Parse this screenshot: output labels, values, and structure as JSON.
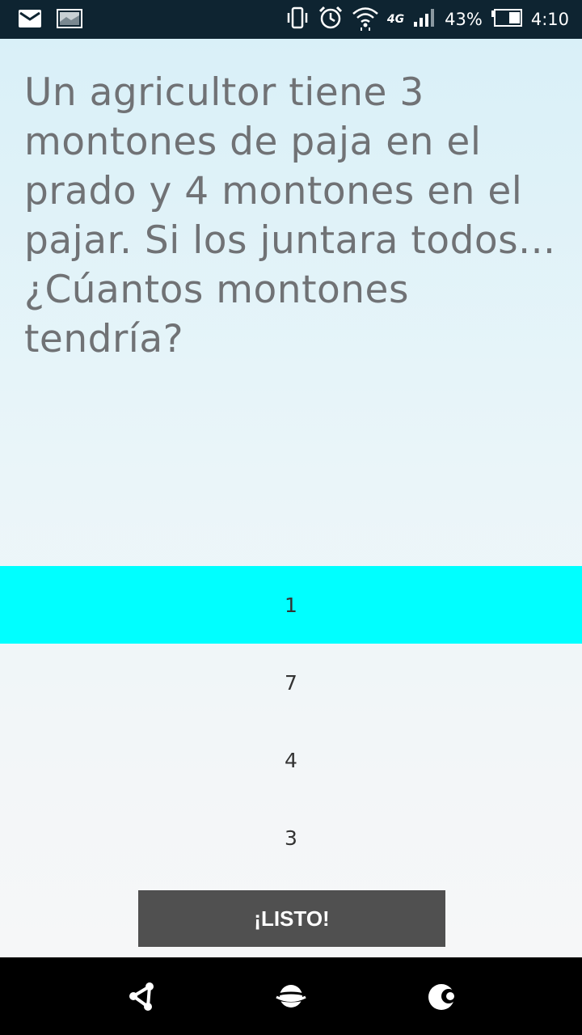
{
  "status_bar": {
    "left_icons": [
      "mail-icon",
      "image-icon"
    ],
    "right_icons": [
      "vibrate-icon",
      "alarm-icon",
      "wifi-icon",
      "signal-icon",
      "battery-icon"
    ],
    "network_label": "4G",
    "battery_percent": "43%",
    "battery_level": 0.43,
    "time": "4:10"
  },
  "quiz": {
    "question": "Un agricultor tiene 3 montones de paja en el prado y 4 montones en el pajar. Si los juntara todos... ¿Cúantos montones tendría?",
    "options": [
      {
        "label": "1",
        "selected": true
      },
      {
        "label": "7",
        "selected": false
      },
      {
        "label": "4",
        "selected": false
      },
      {
        "label": "3",
        "selected": false
      }
    ],
    "selected_color": "#00ffff",
    "done_label": "¡LISTO!"
  },
  "bottom_nav": {
    "icons": [
      "share-icon",
      "planet-icon",
      "moon-icon"
    ]
  }
}
